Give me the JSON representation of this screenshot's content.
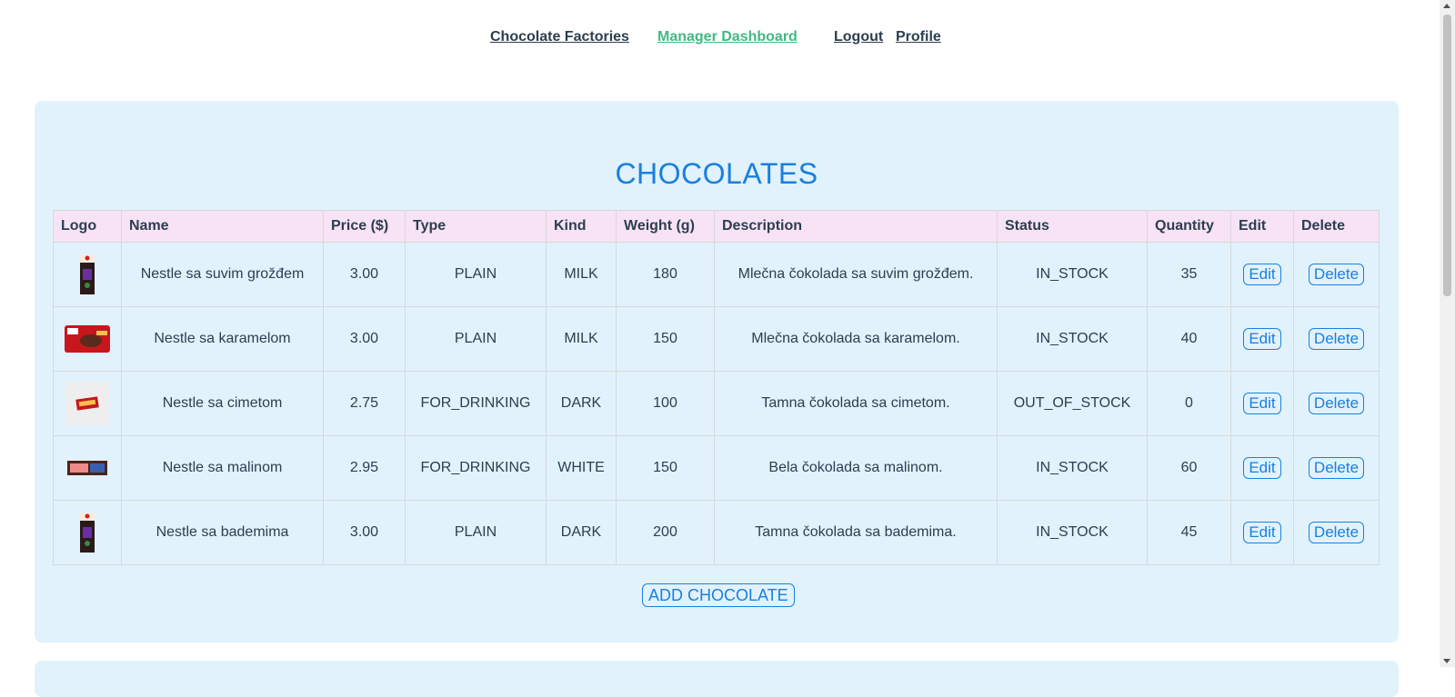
{
  "nav": {
    "factories": "Chocolate Factories",
    "dashboard": "Manager Dashboard",
    "logout": "Logout",
    "profile": "Profile"
  },
  "page": {
    "title": "CHOCOLATES",
    "add_button": "ADD CHOCOLATE"
  },
  "table": {
    "headers": [
      "Logo",
      "Name",
      "Price ($)",
      "Type",
      "Kind",
      "Weight (g)",
      "Description",
      "Status",
      "Quantity",
      "Edit",
      "Delete"
    ],
    "edit_label": "Edit",
    "delete_label": "Delete",
    "rows": [
      {
        "logo": "tall-bar-icon",
        "name": "Nestle sa suvim grožđem",
        "price": "3.00",
        "type": "PLAIN",
        "kind": "MILK",
        "weight": "180",
        "description": "Mlečna čokolada sa suvim grožđem.",
        "status": "IN_STOCK",
        "quantity": "35"
      },
      {
        "logo": "red-wrapper-icon",
        "name": "Nestle sa karamelom",
        "price": "3.00",
        "type": "PLAIN",
        "kind": "MILK",
        "weight": "150",
        "description": "Mlečna čokolada sa karamelom.",
        "status": "IN_STOCK",
        "quantity": "40"
      },
      {
        "logo": "small-bar-icon",
        "name": "Nestle sa cimetom",
        "price": "2.75",
        "type": "FOR_DRINKING",
        "kind": "DARK",
        "weight": "100",
        "description": "Tamna čokolada sa cimetom.",
        "status": "OUT_OF_STOCK",
        "quantity": "0"
      },
      {
        "logo": "flat-bar-icon",
        "name": "Nestle sa malinom",
        "price": "2.95",
        "type": "FOR_DRINKING",
        "kind": "WHITE",
        "weight": "150",
        "description": "Bela čokolada sa malinom.",
        "status": "IN_STOCK",
        "quantity": "60"
      },
      {
        "logo": "tall-bar-icon",
        "name": "Nestle sa bademima",
        "price": "3.00",
        "type": "PLAIN",
        "kind": "DARK",
        "weight": "200",
        "description": "Tamna čokolada sa bademima.",
        "status": "IN_STOCK",
        "quantity": "45"
      }
    ]
  },
  "colors": {
    "accent": "#1a7fe0",
    "active_nav": "#42b983",
    "panel": "#e1f2fd",
    "header_row": "#f7e3f5"
  }
}
